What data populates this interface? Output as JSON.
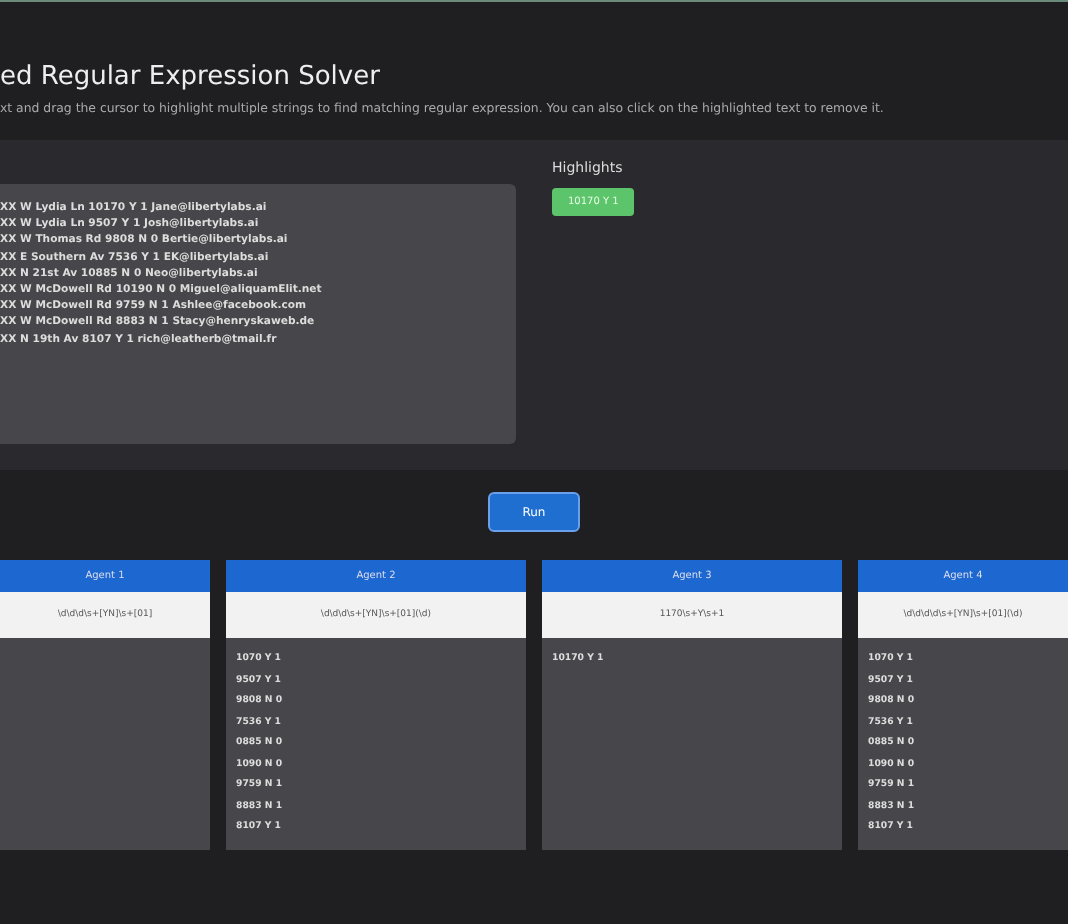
{
  "header": {
    "title": "ed Regular Expression Solver",
    "subtitle": "xt and drag the cursor to highlight multiple strings to find matching regular expression. You can also click on the highlighted text to remove it."
  },
  "text_lines": [
    "XX W Lydia Ln 10170 Y 1 Jane@libertylabs.ai",
    "XX W Lydia Ln 9507 Y 1 Josh@libertylabs.ai",
    "XX W Thomas Rd 9808 N 0 Bertie@libertylabs.ai",
    "XX E Southern Av 7536 Y 1 EK@libertylabs.ai",
    "XX N 21st Av 10885 N 0 Neo@libertylabs.ai",
    "XX W McDowell Rd 10190 N 0 Miguel@aliquamElit.net",
    "XX W McDowell Rd 9759 N 1 Ashlee@facebook.com",
    "XX W McDowell Rd 8883 N 1 Stacy@henryskaweb.de",
    "XX N 19th Av 8107 Y 1 rich@leatherb@tmail.fr"
  ],
  "highlights": {
    "label": "Highlights",
    "items": [
      "10170 Y 1"
    ]
  },
  "run_button": "Run",
  "agents": [
    {
      "name": "Agent 1",
      "regex": "\\d\\d\\d\\s+[YN]\\s+[01]"
    },
    {
      "name": "Agent 2",
      "regex": "\\d\\d\\d\\s+[YN]\\s+[01](\\d)",
      "matches": [
        "1070 Y 1",
        "9507 Y 1",
        "9808 N 0",
        "7536 Y 1",
        "0885 N 0",
        "1090 N 0",
        "9759 N 1",
        "8883 N 1",
        "8107 Y 1"
      ]
    },
    {
      "name": "Agent 3",
      "regex": "1170\\s+Y\\s+1",
      "matches": [
        "10170 Y 1"
      ]
    },
    {
      "name": "Agent 4",
      "regex": "\\d\\d\\d\\d\\s+[YN]\\s+[01](\\d)",
      "matches": [
        "1070 Y 1",
        "9507 Y 1",
        "9808 N 0",
        "7536 Y 1",
        "0885 N 0",
        "1090 N 0",
        "9759 N 1",
        "8883 N 1",
        "8107 Y 1"
      ]
    }
  ]
}
